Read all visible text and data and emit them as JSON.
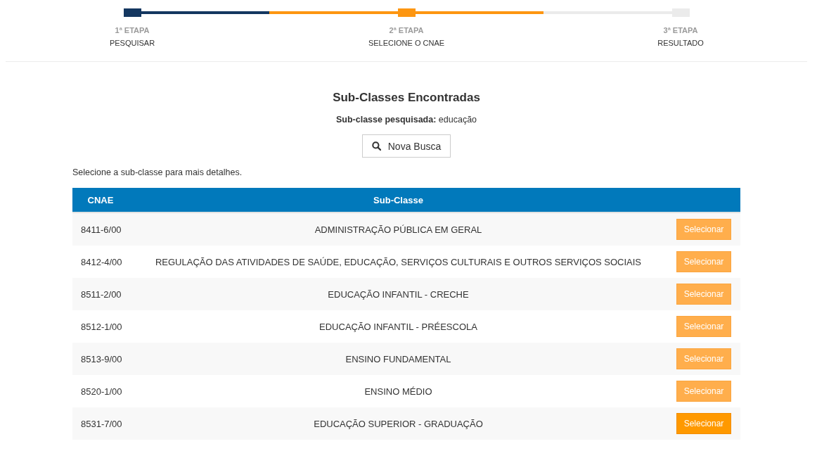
{
  "progress": {
    "steps": [
      {
        "number": "1ª ETAPA",
        "label": "PESQUISAR",
        "done": true,
        "active": false
      },
      {
        "number": "2ª ETAPA",
        "label": "SELECIONE O CNAE",
        "done": false,
        "active": true
      },
      {
        "number": "3ª ETAPA",
        "label": "RESULTADO",
        "done": false,
        "active": false
      }
    ]
  },
  "results": {
    "title": "Sub-Classes Encontradas",
    "query": "**Sub-classe pesquisada:** educação",
    "new_search_button": "Nova Busca",
    "instruction": "Selecione a sub-classe para mais detalhes.",
    "table": {
      "columns": [
        "CNAE",
        "Sub-Classe"
      ],
      "rows": [
        {
          "cnae": "8411-6/00",
          "sub_class": "ADMINISTRAÇÃO PÚBLICA EM GERAL",
          "action": "Selecionar",
          "hovered": false
        },
        {
          "cnae": "8412-4/00",
          "sub_class": "REGULAÇÃO DAS ATIVIDADES DE SAÚDE, EDUCAÇÃO, SERVIÇOS CULTURAIS E OUTROS SERVIÇOS SOCIAIS",
          "action": "Selecionar",
          "hovered": false
        },
        {
          "cnae": "8511-2/00",
          "sub_class": "EDUCAÇÃO INFANTIL - CRECHE",
          "action": "Selecionar",
          "hovered": false
        },
        {
          "cnae": "8512-1/00",
          "sub_class": "EDUCAÇÃO INFANTIL - PRÉESCOLA",
          "action": "Selecionar",
          "hovered": false
        },
        {
          "cnae": "8513-9/00",
          "sub_class": "ENSINO FUNDAMENTAL",
          "action": "Selecionar",
          "hovered": false
        },
        {
          "cnae": "8520-1/00",
          "sub_class": "ENSINO MÉDIO",
          "action": "Selecionar",
          "hovered": false
        },
        {
          "cnae": "8531-7/00",
          "sub_class": "EDUCAÇÃO SUPERIOR - GRADUAÇÃO",
          "action": "Selecionar",
          "hovered": true
        }
      ]
    }
  }
}
